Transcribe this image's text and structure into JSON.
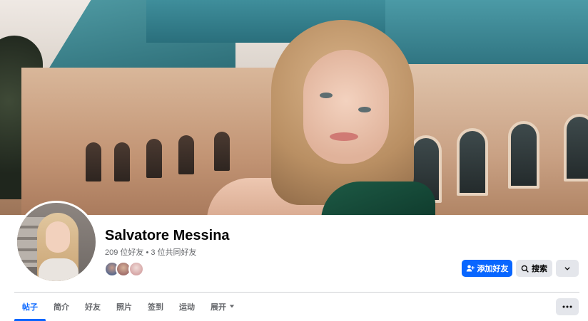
{
  "profile": {
    "name": "Salvatore Messina",
    "friends_summary": "209 位好友 • 3 位共同好友",
    "mutual_friend_count_shown": 3
  },
  "actions": {
    "add_friend_label": "添加好友",
    "search_label": "搜索"
  },
  "tabs": [
    {
      "label": "帖子",
      "active": true
    },
    {
      "label": "简介",
      "active": false
    },
    {
      "label": "好友",
      "active": false
    },
    {
      "label": "照片",
      "active": false
    },
    {
      "label": "签到",
      "active": false
    },
    {
      "label": "运动",
      "active": false
    },
    {
      "label": "展开",
      "active": false
    }
  ],
  "icons": {
    "add_friend": "person-plus-icon",
    "search": "search-icon",
    "dropdown": "chevron-down-icon",
    "overflow": "more-dots-icon"
  },
  "colors": {
    "accent": "#0866ff",
    "secondary_button": "#e4e6eb",
    "muted_text": "#65676b"
  }
}
